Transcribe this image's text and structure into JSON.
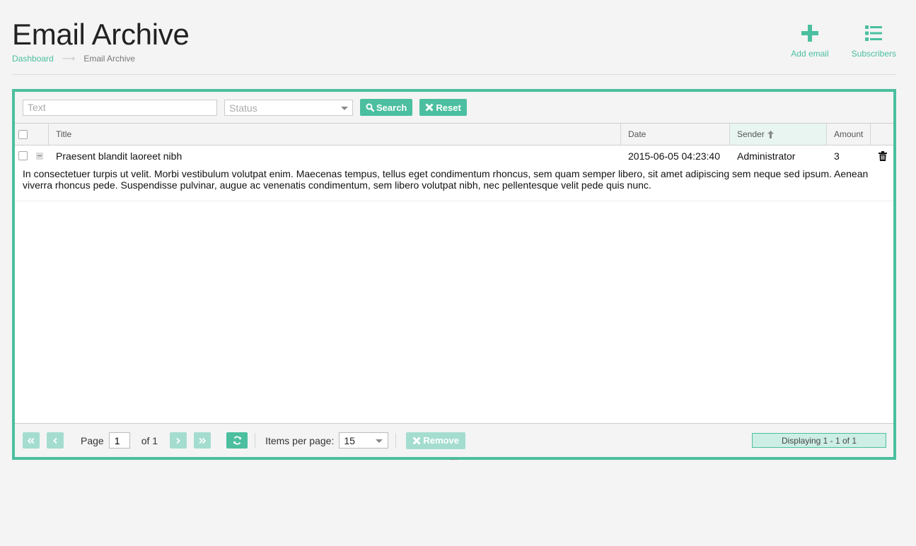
{
  "page": {
    "title": "Email Archive"
  },
  "breadcrumb": {
    "home": "Dashboard",
    "current": "Email Archive"
  },
  "actions": {
    "add_email": "Add email",
    "subscribers": "Subscribers"
  },
  "toolbar": {
    "text_placeholder": "Text",
    "status_placeholder": "Status",
    "search_label": "Search",
    "reset_label": "Reset"
  },
  "grid": {
    "columns": {
      "title": "Title",
      "date": "Date",
      "sender": "Sender",
      "amount": "Amount"
    },
    "sort": {
      "column": "sender",
      "direction": "asc"
    },
    "rows": [
      {
        "title": "Praesent blandit laoreet nibh",
        "date": "2015-06-05 04:23:40",
        "sender": "Administrator",
        "amount": "3",
        "detail": "In consectetuer turpis ut velit. Morbi vestibulum volutpat enim. Maecenas tempus, tellus eget condimentum rhoncus, sem quam semper libero, sit amet adipiscing sem neque sed ipsum. Aenean viverra rhoncus pede. Suspendisse pulvinar, augue ac venenatis condimentum, sem libero volutpat nibh, nec pellentesque velit pede quis nunc."
      }
    ]
  },
  "pager": {
    "page_label": "Page",
    "page_value": "1",
    "of_label": "of 1",
    "items_per_page_label": "Items per page:",
    "items_per_page_value": "15",
    "remove_label": "Remove",
    "display_info": "Displaying 1 - 1 of 1"
  },
  "colors": {
    "accent": "#4bbf9f",
    "accent_light": "#a4ddd0",
    "background": "#f4f4f4"
  }
}
